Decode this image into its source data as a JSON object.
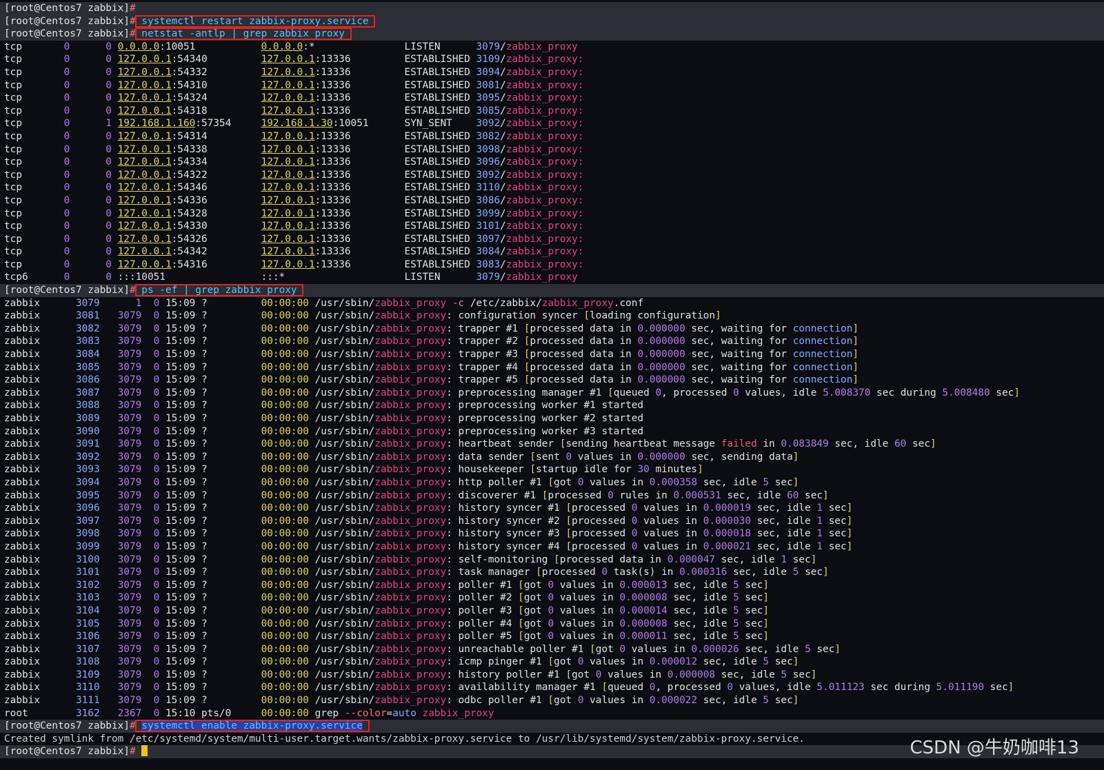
{
  "window": {
    "title": ""
  },
  "prompt": "[root@Centos7 zabbix]",
  "commands": {
    "restart": "systemctl restart zabbix-proxy.service",
    "netstat": "netstat -antlp | grep zabbix_proxy",
    "ps": "ps -ef | grep zabbix_proxy",
    "enable": "systemctl enable zabbix-proxy.service"
  },
  "netstat_rows": [
    {
      "proto": "tcp",
      "recv": "0",
      "send": "0",
      "local": "0.0.0.0:10051",
      "foreign": "0.0.0.0:*",
      "state": "LISTEN",
      "pid": "3079/zabbix_proxy"
    },
    {
      "proto": "tcp",
      "recv": "0",
      "send": "0",
      "local": "127.0.0.1:54340",
      "foreign": "127.0.0.1:13336",
      "state": "ESTABLISHED",
      "pid": "3109/zabbix_proxy:"
    },
    {
      "proto": "tcp",
      "recv": "0",
      "send": "0",
      "local": "127.0.0.1:54332",
      "foreign": "127.0.0.1:13336",
      "state": "ESTABLISHED",
      "pid": "3094/zabbix_proxy:"
    },
    {
      "proto": "tcp",
      "recv": "0",
      "send": "0",
      "local": "127.0.0.1:54310",
      "foreign": "127.0.0.1:13336",
      "state": "ESTABLISHED",
      "pid": "3081/zabbix_proxy:"
    },
    {
      "proto": "tcp",
      "recv": "0",
      "send": "0",
      "local": "127.0.0.1:54324",
      "foreign": "127.0.0.1:13336",
      "state": "ESTABLISHED",
      "pid": "3095/zabbix_proxy:"
    },
    {
      "proto": "tcp",
      "recv": "0",
      "send": "0",
      "local": "127.0.0.1:54318",
      "foreign": "127.0.0.1:13336",
      "state": "ESTABLISHED",
      "pid": "3085/zabbix_proxy:"
    },
    {
      "proto": "tcp",
      "recv": "0",
      "send": "1",
      "local": "192.168.1.160:57354",
      "foreign": "192.168.1.30:10051",
      "state": "SYN_SENT",
      "pid": "3092/zabbix_proxy:"
    },
    {
      "proto": "tcp",
      "recv": "0",
      "send": "0",
      "local": "127.0.0.1:54314",
      "foreign": "127.0.0.1:13336",
      "state": "ESTABLISHED",
      "pid": "3082/zabbix_proxy:"
    },
    {
      "proto": "tcp",
      "recv": "0",
      "send": "0",
      "local": "127.0.0.1:54338",
      "foreign": "127.0.0.1:13336",
      "state": "ESTABLISHED",
      "pid": "3098/zabbix_proxy:"
    },
    {
      "proto": "tcp",
      "recv": "0",
      "send": "0",
      "local": "127.0.0.1:54334",
      "foreign": "127.0.0.1:13336",
      "state": "ESTABLISHED",
      "pid": "3096/zabbix_proxy:"
    },
    {
      "proto": "tcp",
      "recv": "0",
      "send": "0",
      "local": "127.0.0.1:54322",
      "foreign": "127.0.0.1:13336",
      "state": "ESTABLISHED",
      "pid": "3092/zabbix_proxy:"
    },
    {
      "proto": "tcp",
      "recv": "0",
      "send": "0",
      "local": "127.0.0.1:54346",
      "foreign": "127.0.0.1:13336",
      "state": "ESTABLISHED",
      "pid": "3110/zabbix_proxy:"
    },
    {
      "proto": "tcp",
      "recv": "0",
      "send": "0",
      "local": "127.0.0.1:54336",
      "foreign": "127.0.0.1:13336",
      "state": "ESTABLISHED",
      "pid": "3086/zabbix_proxy:"
    },
    {
      "proto": "tcp",
      "recv": "0",
      "send": "0",
      "local": "127.0.0.1:54328",
      "foreign": "127.0.0.1:13336",
      "state": "ESTABLISHED",
      "pid": "3099/zabbix_proxy:"
    },
    {
      "proto": "tcp",
      "recv": "0",
      "send": "0",
      "local": "127.0.0.1:54330",
      "foreign": "127.0.0.1:13336",
      "state": "ESTABLISHED",
      "pid": "3101/zabbix_proxy:"
    },
    {
      "proto": "tcp",
      "recv": "0",
      "send": "0",
      "local": "127.0.0.1:54326",
      "foreign": "127.0.0.1:13336",
      "state": "ESTABLISHED",
      "pid": "3097/zabbix_proxy:"
    },
    {
      "proto": "tcp",
      "recv": "0",
      "send": "0",
      "local": "127.0.0.1:54342",
      "foreign": "127.0.0.1:13336",
      "state": "ESTABLISHED",
      "pid": "3084/zabbix_proxy:"
    },
    {
      "proto": "tcp",
      "recv": "0",
      "send": "0",
      "local": "127.0.0.1:54316",
      "foreign": "127.0.0.1:13336",
      "state": "ESTABLISHED",
      "pid": "3083/zabbix_proxy:"
    },
    {
      "proto": "tcp6",
      "recv": "0",
      "send": "0",
      "local": ":::10051",
      "foreign": ":::*",
      "state": "LISTEN",
      "pid": "3079/zabbix_proxy"
    }
  ],
  "ps_rows": [
    {
      "user": "zabbix",
      "pid": "3079",
      "ppid": "1",
      "c": "0",
      "stime": "15:09",
      "tty": "?",
      "time": "00:00:00",
      "cmd": "/usr/sbin/zabbix_proxy -c /etc/zabbix/zabbix_proxy.conf"
    },
    {
      "user": "zabbix",
      "pid": "3081",
      "ppid": "3079",
      "c": "0",
      "stime": "15:09",
      "tty": "?",
      "time": "00:00:00",
      "cmd": "/usr/sbin/zabbix_proxy: configuration syncer [loading configuration]"
    },
    {
      "user": "zabbix",
      "pid": "3082",
      "ppid": "3079",
      "c": "0",
      "stime": "15:09",
      "tty": "?",
      "time": "00:00:00",
      "cmd": "/usr/sbin/zabbix_proxy: trapper #1 [processed data in 0.000000 sec, waiting for connection]"
    },
    {
      "user": "zabbix",
      "pid": "3083",
      "ppid": "3079",
      "c": "0",
      "stime": "15:09",
      "tty": "?",
      "time": "00:00:00",
      "cmd": "/usr/sbin/zabbix_proxy: trapper #2 [processed data in 0.000000 sec, waiting for connection]"
    },
    {
      "user": "zabbix",
      "pid": "3084",
      "ppid": "3079",
      "c": "0",
      "stime": "15:09",
      "tty": "?",
      "time": "00:00:00",
      "cmd": "/usr/sbin/zabbix_proxy: trapper #3 [processed data in 0.000000 sec, waiting for connection]"
    },
    {
      "user": "zabbix",
      "pid": "3085",
      "ppid": "3079",
      "c": "0",
      "stime": "15:09",
      "tty": "?",
      "time": "00:00:00",
      "cmd": "/usr/sbin/zabbix_proxy: trapper #4 [processed data in 0.000000 sec, waiting for connection]"
    },
    {
      "user": "zabbix",
      "pid": "3086",
      "ppid": "3079",
      "c": "0",
      "stime": "15:09",
      "tty": "?",
      "time": "00:00:00",
      "cmd": "/usr/sbin/zabbix_proxy: trapper #5 [processed data in 0.000000 sec, waiting for connection]"
    },
    {
      "user": "zabbix",
      "pid": "3087",
      "ppid": "3079",
      "c": "0",
      "stime": "15:09",
      "tty": "?",
      "time": "00:00:00",
      "cmd": "/usr/sbin/zabbix_proxy: preprocessing manager #1 [queued 0, processed 0 values, idle 5.008370 sec during 5.008480 sec]"
    },
    {
      "user": "zabbix",
      "pid": "3088",
      "ppid": "3079",
      "c": "0",
      "stime": "15:09",
      "tty": "?",
      "time": "00:00:00",
      "cmd": "/usr/sbin/zabbix_proxy: preprocessing worker #1 started"
    },
    {
      "user": "zabbix",
      "pid": "3089",
      "ppid": "3079",
      "c": "0",
      "stime": "15:09",
      "tty": "?",
      "time": "00:00:00",
      "cmd": "/usr/sbin/zabbix_proxy: preprocessing worker #2 started"
    },
    {
      "user": "zabbix",
      "pid": "3090",
      "ppid": "3079",
      "c": "0",
      "stime": "15:09",
      "tty": "?",
      "time": "00:00:00",
      "cmd": "/usr/sbin/zabbix_proxy: preprocessing worker #3 started"
    },
    {
      "user": "zabbix",
      "pid": "3091",
      "ppid": "3079",
      "c": "0",
      "stime": "15:09",
      "tty": "?",
      "time": "00:00:00",
      "cmd": "/usr/sbin/zabbix_proxy: heartbeat sender [sending heartbeat message failed in 0.083849 sec, idle 60 sec]"
    },
    {
      "user": "zabbix",
      "pid": "3092",
      "ppid": "3079",
      "c": "0",
      "stime": "15:09",
      "tty": "?",
      "time": "00:00:00",
      "cmd": "/usr/sbin/zabbix_proxy: data sender [sent 0 values in 0.000000 sec, sending data]"
    },
    {
      "user": "zabbix",
      "pid": "3093",
      "ppid": "3079",
      "c": "0",
      "stime": "15:09",
      "tty": "?",
      "time": "00:00:00",
      "cmd": "/usr/sbin/zabbix_proxy: housekeeper [startup idle for 30 minutes]"
    },
    {
      "user": "zabbix",
      "pid": "3094",
      "ppid": "3079",
      "c": "0",
      "stime": "15:09",
      "tty": "?",
      "time": "00:00:00",
      "cmd": "/usr/sbin/zabbix_proxy: http poller #1 [got 0 values in 0.000358 sec, idle 5 sec]"
    },
    {
      "user": "zabbix",
      "pid": "3095",
      "ppid": "3079",
      "c": "0",
      "stime": "15:09",
      "tty": "?",
      "time": "00:00:00",
      "cmd": "/usr/sbin/zabbix_proxy: discoverer #1 [processed 0 rules in 0.000531 sec, idle 60 sec]"
    },
    {
      "user": "zabbix",
      "pid": "3096",
      "ppid": "3079",
      "c": "0",
      "stime": "15:09",
      "tty": "?",
      "time": "00:00:00",
      "cmd": "/usr/sbin/zabbix_proxy: history syncer #1 [processed 0 values in 0.000019 sec, idle 1 sec]"
    },
    {
      "user": "zabbix",
      "pid": "3097",
      "ppid": "3079",
      "c": "0",
      "stime": "15:09",
      "tty": "?",
      "time": "00:00:00",
      "cmd": "/usr/sbin/zabbix_proxy: history syncer #2 [processed 0 values in 0.000030 sec, idle 1 sec]"
    },
    {
      "user": "zabbix",
      "pid": "3098",
      "ppid": "3079",
      "c": "0",
      "stime": "15:09",
      "tty": "?",
      "time": "00:00:00",
      "cmd": "/usr/sbin/zabbix_proxy: history syncer #3 [processed 0 values in 0.000018 sec, idle 1 sec]"
    },
    {
      "user": "zabbix",
      "pid": "3099",
      "ppid": "3079",
      "c": "0",
      "stime": "15:09",
      "tty": "?",
      "time": "00:00:00",
      "cmd": "/usr/sbin/zabbix_proxy: history syncer #4 [processed 0 values in 0.000021 sec, idle 1 sec]"
    },
    {
      "user": "zabbix",
      "pid": "3100",
      "ppid": "3079",
      "c": "0",
      "stime": "15:09",
      "tty": "?",
      "time": "00:00:00",
      "cmd": "/usr/sbin/zabbix_proxy: self-monitoring [processed data in 0.000047 sec, idle 1 sec]"
    },
    {
      "user": "zabbix",
      "pid": "3101",
      "ppid": "3079",
      "c": "0",
      "stime": "15:09",
      "tty": "?",
      "time": "00:00:00",
      "cmd": "/usr/sbin/zabbix_proxy: task manager [processed 0 task(s) in 0.000316 sec, idle 5 sec]"
    },
    {
      "user": "zabbix",
      "pid": "3102",
      "ppid": "3079",
      "c": "0",
      "stime": "15:09",
      "tty": "?",
      "time": "00:00:00",
      "cmd": "/usr/sbin/zabbix_proxy: poller #1 [got 0 values in 0.000013 sec, idle 5 sec]"
    },
    {
      "user": "zabbix",
      "pid": "3103",
      "ppid": "3079",
      "c": "0",
      "stime": "15:09",
      "tty": "?",
      "time": "00:00:00",
      "cmd": "/usr/sbin/zabbix_proxy: poller #2 [got 0 values in 0.000008 sec, idle 5 sec]"
    },
    {
      "user": "zabbix",
      "pid": "3104",
      "ppid": "3079",
      "c": "0",
      "stime": "15:09",
      "tty": "?",
      "time": "00:00:00",
      "cmd": "/usr/sbin/zabbix_proxy: poller #3 [got 0 values in 0.000014 sec, idle 5 sec]"
    },
    {
      "user": "zabbix",
      "pid": "3105",
      "ppid": "3079",
      "c": "0",
      "stime": "15:09",
      "tty": "?",
      "time": "00:00:00",
      "cmd": "/usr/sbin/zabbix_proxy: poller #4 [got 0 values in 0.000008 sec, idle 5 sec]"
    },
    {
      "user": "zabbix",
      "pid": "3106",
      "ppid": "3079",
      "c": "0",
      "stime": "15:09",
      "tty": "?",
      "time": "00:00:00",
      "cmd": "/usr/sbin/zabbix_proxy: poller #5 [got 0 values in 0.000011 sec, idle 5 sec]"
    },
    {
      "user": "zabbix",
      "pid": "3107",
      "ppid": "3079",
      "c": "0",
      "stime": "15:09",
      "tty": "?",
      "time": "00:00:00",
      "cmd": "/usr/sbin/zabbix_proxy: unreachable poller #1 [got 0 values in 0.000026 sec, idle 5 sec]"
    },
    {
      "user": "zabbix",
      "pid": "3108",
      "ppid": "3079",
      "c": "0",
      "stime": "15:09",
      "tty": "?",
      "time": "00:00:00",
      "cmd": "/usr/sbin/zabbix_proxy: icmp pinger #1 [got 0 values in 0.000012 sec, idle 5 sec]"
    },
    {
      "user": "zabbix",
      "pid": "3109",
      "ppid": "3079",
      "c": "0",
      "stime": "15:09",
      "tty": "?",
      "time": "00:00:00",
      "cmd": "/usr/sbin/zabbix_proxy: history poller #1 [got 0 values in 0.000008 sec, idle 5 sec]"
    },
    {
      "user": "zabbix",
      "pid": "3110",
      "ppid": "3079",
      "c": "0",
      "stime": "15:09",
      "tty": "?",
      "time": "00:00:00",
      "cmd": "/usr/sbin/zabbix_proxy: availability manager #1 [queued 0, processed 0 values, idle 5.011123 sec during 5.011190 sec]"
    },
    {
      "user": "zabbix",
      "pid": "3111",
      "ppid": "3079",
      "c": "0",
      "stime": "15:09",
      "tty": "?",
      "time": "00:00:00",
      "cmd": "/usr/sbin/zabbix_proxy: odbc poller #1 [got 0 values in 0.000022 sec, idle 5 sec]"
    },
    {
      "user": "root",
      "pid": "3162",
      "ppid": "2367",
      "c": "0",
      "stime": "15:10",
      "tty": "pts/0",
      "time": "00:00:00",
      "cmd": "grep --color=auto zabbix_proxy"
    }
  ],
  "symlink_output": "Created symlink from /etc/systemd/system/multi-user.target.wants/zabbix-proxy.service to /usr/lib/systemd/system/zabbix-proxy.service.",
  "watermark": "CSDN @牛奶咖啡13",
  "colors": {
    "background": "#0b0d13",
    "prompt_bar": "#2b2e34",
    "command": "#58c2ff",
    "highlight_box": "#e5221e",
    "process_name": "#e6407d",
    "ip_underline": "#e0d560",
    "number": "#b27ae8",
    "cursor": "#f4c20d"
  }
}
